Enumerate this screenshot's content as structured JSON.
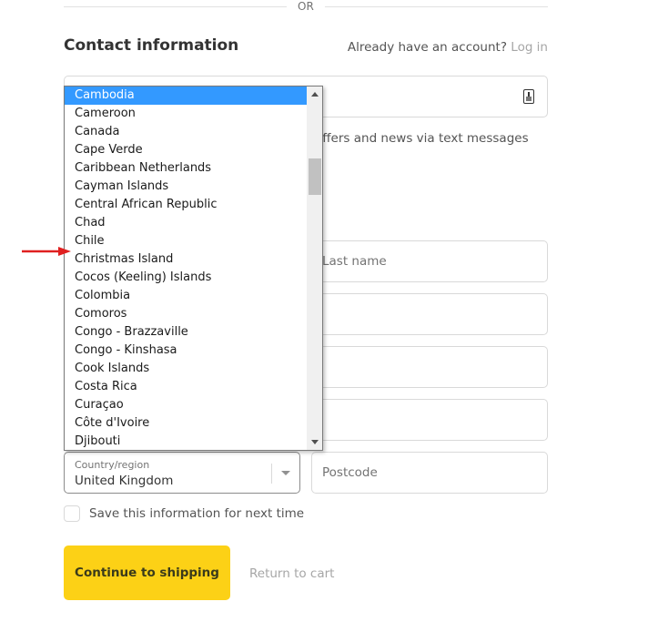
{
  "divider": {
    "text": "OR"
  },
  "contact": {
    "title": "Contact information",
    "account_prompt": "Already have an account?",
    "login_link": "Log in",
    "contact_icon": "contact-card-icon",
    "offers_text": "offers and news via text messages"
  },
  "shipping": {
    "last_name_placeholder": "Last name",
    "postcode_placeholder": "Postcode",
    "country": {
      "label": "Country/region",
      "value": "United Kingdom",
      "caret_icon": "chevron-down-icon"
    },
    "save_info_label": "Save this information for next time"
  },
  "actions": {
    "continue_label": "Continue to shipping",
    "return_label": "Return to cart"
  },
  "dropdown": {
    "selected_index": 0,
    "options": [
      "Cambodia",
      "Cameroon",
      "Canada",
      "Cape Verde",
      "Caribbean Netherlands",
      "Cayman Islands",
      "Central African Republic",
      "Chad",
      "Chile",
      "Christmas Island",
      "Cocos (Keeling) Islands",
      "Colombia",
      "Comoros",
      "Congo - Brazzaville",
      "Congo - Kinshasa",
      "Cook Islands",
      "Costa Rica",
      "Curaçao",
      "Côte d'Ivoire",
      "Djibouti"
    ],
    "scroll_position_fraction": 0.19,
    "visible_fraction": 0.11
  },
  "annotation": {
    "arrow_color": "#e02020",
    "points_to": "Christmas Island"
  },
  "colors": {
    "accent_button": "#fcd116",
    "selected_option": "#3399ff"
  }
}
